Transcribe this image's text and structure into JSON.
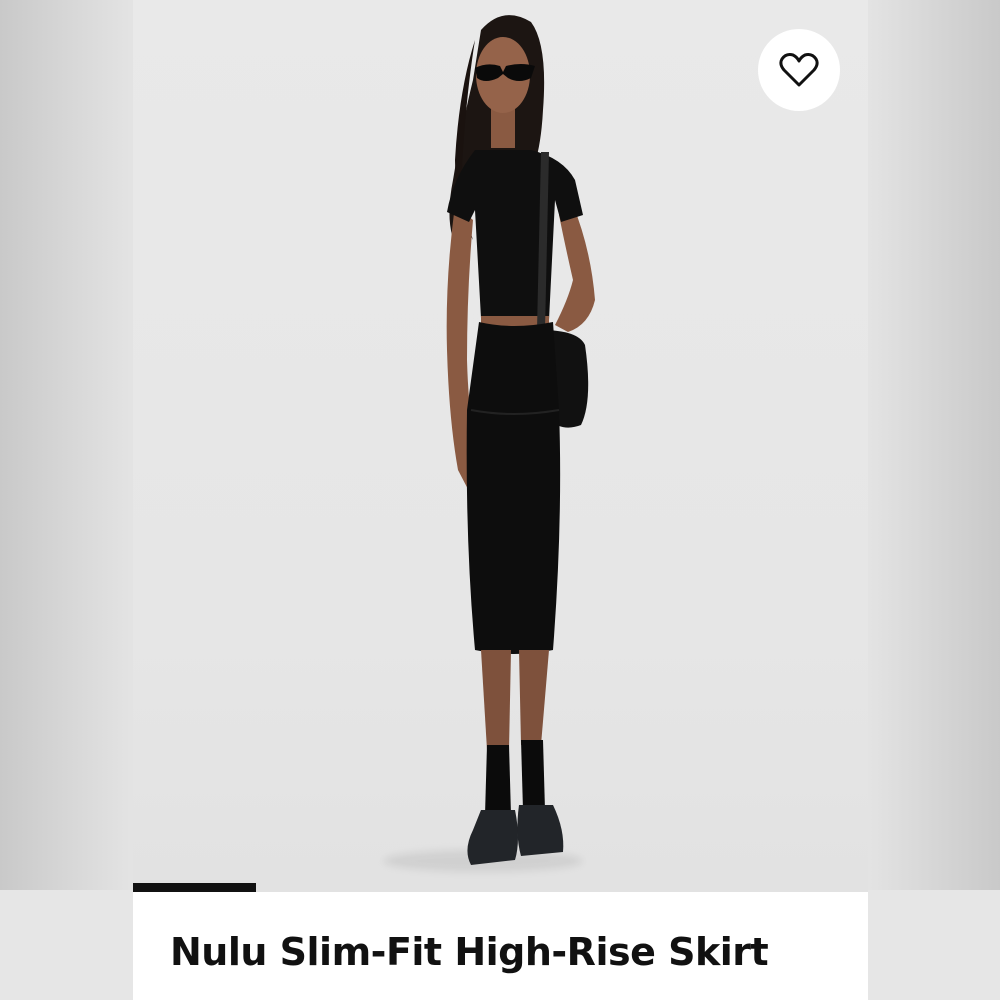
{
  "product": {
    "title": "Nulu Slim-Fit High-Rise Skirt",
    "image_alt": "model-wearing-black-skirt-and-top-with-black-bag",
    "favorite_icon": "heart-outline-icon"
  },
  "gallery": {
    "progress_fraction": 0.167
  },
  "colors": {
    "page_bg": "#e3e3e3",
    "card_bg": "#ffffff",
    "photo_bg": "#e8e8e8",
    "text": "#111111",
    "garment": "#0d0d0d",
    "skin": "#8a5a42"
  }
}
